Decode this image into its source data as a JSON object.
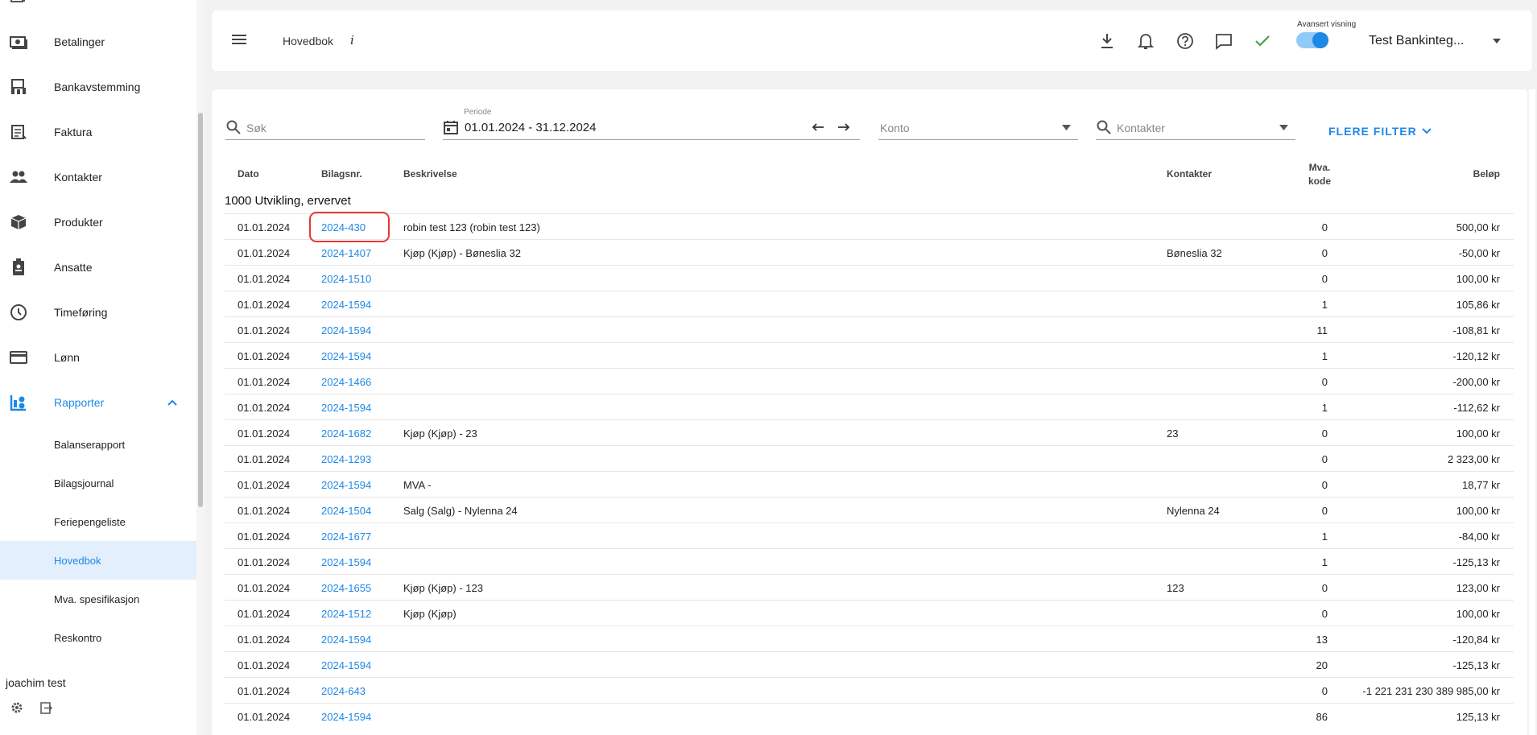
{
  "sidebar": {
    "items": [
      {
        "label": "Betalinger",
        "icon": "payments-icon"
      },
      {
        "label": "Bankavstemming",
        "icon": "bank-reconcile-icon"
      },
      {
        "label": "Faktura",
        "icon": "invoice-icon"
      },
      {
        "label": "Kontakter",
        "icon": "people-icon"
      },
      {
        "label": "Produkter",
        "icon": "box-icon"
      },
      {
        "label": "Ansatte",
        "icon": "badge-icon"
      },
      {
        "label": "Timeføring",
        "icon": "clock-icon"
      },
      {
        "label": "Lønn",
        "icon": "card-icon"
      },
      {
        "label": "Rapporter",
        "icon": "reports-icon"
      }
    ],
    "subitems": [
      {
        "label": "Balanserapport"
      },
      {
        "label": "Bilagsjournal"
      },
      {
        "label": "Feriepengeliste"
      },
      {
        "label": "Hovedbok"
      },
      {
        "label": "Mva. spesifikasjon"
      },
      {
        "label": "Reskontro"
      }
    ],
    "user_name": "joachim test"
  },
  "header": {
    "title": "Hovedbok",
    "info": "i",
    "advanced_label": "Avansert visning",
    "company": "Test Bankinteg..."
  },
  "filters": {
    "search_placeholder": "Søk",
    "period_label": "Periode",
    "period_value": "01.01.2024 - 31.12.2024",
    "konto_placeholder": "Konto",
    "kontakter_placeholder": "Kontakter",
    "more_filters": "FLERE FILTER"
  },
  "table": {
    "headers": {
      "dato": "Dato",
      "bilag": "Bilagsnr.",
      "beskrivelse": "Beskrivelse",
      "kontakter": "Kontakter",
      "mva_1": "Mva.",
      "mva_2": "kode",
      "belop": "Beløp"
    },
    "group": "1000 Utvikling, ervervet",
    "rows": [
      {
        "dato": "01.01.2024",
        "bilag": "2024-430",
        "beskrivelse": "robin test 123 (robin test 123)",
        "kontakt": "",
        "mva": "0",
        "belop": "500,00 kr"
      },
      {
        "dato": "01.01.2024",
        "bilag": "2024-1407",
        "beskrivelse": "Kjøp (Kjøp) - Bøneslia 32",
        "kontakt": "Bøneslia 32",
        "mva": "0",
        "belop": "-50,00 kr"
      },
      {
        "dato": "01.01.2024",
        "bilag": "2024-1510",
        "beskrivelse": "",
        "kontakt": "",
        "mva": "0",
        "belop": "100,00 kr"
      },
      {
        "dato": "01.01.2024",
        "bilag": "2024-1594",
        "beskrivelse": "",
        "kontakt": "",
        "mva": "1",
        "belop": "105,86 kr"
      },
      {
        "dato": "01.01.2024",
        "bilag": "2024-1594",
        "beskrivelse": "",
        "kontakt": "",
        "mva": "11",
        "belop": "-108,81 kr"
      },
      {
        "dato": "01.01.2024",
        "bilag": "2024-1594",
        "beskrivelse": "",
        "kontakt": "",
        "mva": "1",
        "belop": "-120,12 kr"
      },
      {
        "dato": "01.01.2024",
        "bilag": "2024-1466",
        "beskrivelse": "",
        "kontakt": "",
        "mva": "0",
        "belop": "-200,00 kr"
      },
      {
        "dato": "01.01.2024",
        "bilag": "2024-1594",
        "beskrivelse": "",
        "kontakt": "",
        "mva": "1",
        "belop": "-112,62 kr"
      },
      {
        "dato": "01.01.2024",
        "bilag": "2024-1682",
        "beskrivelse": "Kjøp (Kjøp) - 23",
        "kontakt": "23",
        "mva": "0",
        "belop": "100,00 kr"
      },
      {
        "dato": "01.01.2024",
        "bilag": "2024-1293",
        "beskrivelse": "",
        "kontakt": "",
        "mva": "0",
        "belop": "2 323,00 kr"
      },
      {
        "dato": "01.01.2024",
        "bilag": "2024-1594",
        "beskrivelse": "MVA -",
        "kontakt": "",
        "mva": "0",
        "belop": "18,77 kr"
      },
      {
        "dato": "01.01.2024",
        "bilag": "2024-1504",
        "beskrivelse": "Salg (Salg) - Nylenna 24",
        "kontakt": "Nylenna 24",
        "mva": "0",
        "belop": "100,00 kr"
      },
      {
        "dato": "01.01.2024",
        "bilag": "2024-1677",
        "beskrivelse": "",
        "kontakt": "",
        "mva": "1",
        "belop": "-84,00 kr"
      },
      {
        "dato": "01.01.2024",
        "bilag": "2024-1594",
        "beskrivelse": "",
        "kontakt": "",
        "mva": "1",
        "belop": "-125,13 kr"
      },
      {
        "dato": "01.01.2024",
        "bilag": "2024-1655",
        "beskrivelse": "Kjøp (Kjøp) - 123",
        "kontakt": "123",
        "mva": "0",
        "belop": "123,00 kr"
      },
      {
        "dato": "01.01.2024",
        "bilag": "2024-1512",
        "beskrivelse": "Kjøp (Kjøp)",
        "kontakt": "",
        "mva": "0",
        "belop": "100,00 kr"
      },
      {
        "dato": "01.01.2024",
        "bilag": "2024-1594",
        "beskrivelse": "",
        "kontakt": "",
        "mva": "13",
        "belop": "-120,84 kr"
      },
      {
        "dato": "01.01.2024",
        "bilag": "2024-1594",
        "beskrivelse": "",
        "kontakt": "",
        "mva": "20",
        "belop": "-125,13 kr"
      },
      {
        "dato": "01.01.2024",
        "bilag": "2024-643",
        "beskrivelse": "",
        "kontakt": "",
        "mva": "0",
        "belop": "-1 221 231 230 389 985,00 kr"
      },
      {
        "dato": "01.01.2024",
        "bilag": "2024-1594",
        "beskrivelse": "",
        "kontakt": "",
        "mva": "86",
        "belop": "125,13 kr"
      }
    ]
  },
  "colors": {
    "accent": "#1e88e5",
    "highlight": "#e53935",
    "ok": "#43a047"
  }
}
